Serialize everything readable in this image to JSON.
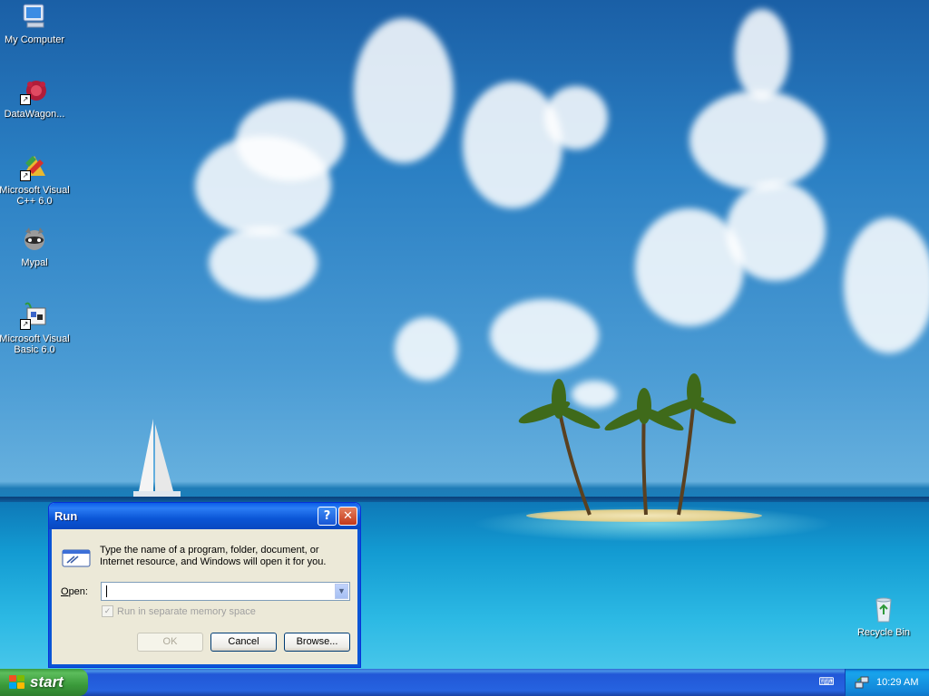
{
  "desktop": {
    "icons": [
      {
        "label": "My Computer",
        "icon": "my-computer-icon"
      },
      {
        "label": "DataWagon...",
        "icon": "datawagon-icon"
      },
      {
        "label_line1": "Microsoft Visual",
        "label_line2": "C++ 6.0",
        "icon": "visual-cpp-icon"
      },
      {
        "label": "Mypal",
        "icon": "mypal-raccoon-icon"
      },
      {
        "label_line1": "Microsoft Visual",
        "label_line2": "Basic 6.0",
        "icon": "visual-basic-icon"
      },
      {
        "label": "Recycle Bin",
        "icon": "recycle-bin-icon"
      }
    ]
  },
  "run_dialog": {
    "title": "Run",
    "help_glyph": "?",
    "close_glyph": "✕",
    "description": "Type the name of a program, folder, document, or Internet resource, and Windows will open it for you.",
    "open_label_underlined": "O",
    "open_label_rest": "pen:",
    "open_value": "",
    "checkbox_label": "Run in separate memory space",
    "checkbox_checked": true,
    "checkbox_enabled": false,
    "ok_label": "OK",
    "cancel_label": "Cancel",
    "browse_label": "Browse..."
  },
  "taskbar": {
    "start_label": "start",
    "clock": "10:29 AM"
  },
  "colors": {
    "title_bar": "#0a55d6",
    "start_button": "#3a9a3a",
    "taskbar": "#2663e0",
    "tray": "#1286d9"
  }
}
